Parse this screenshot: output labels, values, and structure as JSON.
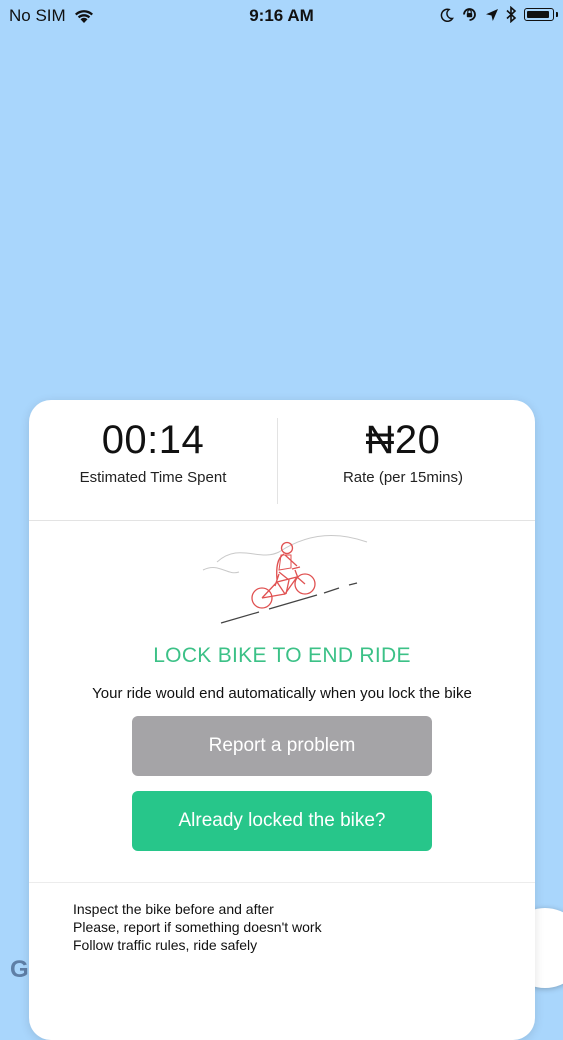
{
  "status_bar": {
    "carrier": "No SIM",
    "time": "9:16 AM",
    "battery_level": 0.9
  },
  "map": {
    "google_logo": "G"
  },
  "ride": {
    "time_value": "00:14",
    "time_label": "Estimated Time Spent",
    "rate_value": "₦20",
    "rate_label": "Rate (per 15mins)",
    "headline": "LOCK BIKE TO END RIDE",
    "subtitle": "Your ride would end automatically when you lock the bike",
    "report_button": "Report a problem",
    "locked_button": "Already locked the bike?",
    "tips": [
      "Inspect the bike before and after",
      "Please, report if something doesn't work",
      "Follow traffic rules, ride safely"
    ]
  },
  "colors": {
    "map_background": "#a9d6fc",
    "accent_green": "#27c68a",
    "headline_green": "#3cc187",
    "report_gray": "#a5a4a7",
    "illustration_red": "#e05252"
  }
}
